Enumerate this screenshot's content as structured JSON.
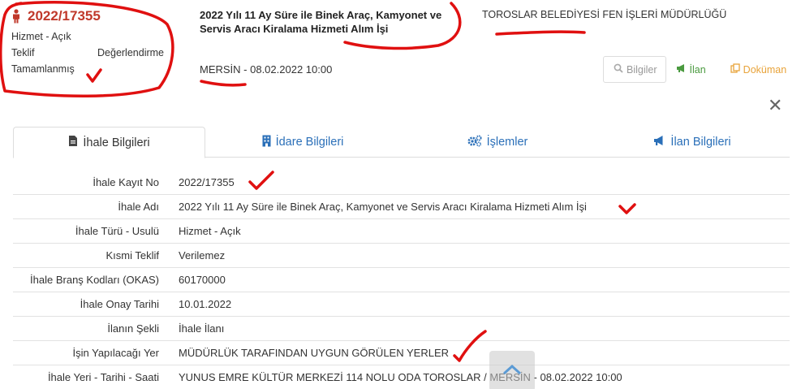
{
  "header": {
    "ikn": "2022/17355",
    "type_line": "Hizmet - Açık",
    "teklif_label": "Teklif",
    "status_eval": "Değerlendirme",
    "status_done": "Tamamlanmış",
    "title": "2022 Yılı 11 Ay Süre ile Binek Araç, Kamyonet ve Servis Aracı Kiralama Hizmeti Alım İşi",
    "organization": "TOROSLAR BELEDİYESİ FEN İŞLERİ MÜDÜRLÜĞÜ",
    "location_date": "MERSİN - 08.02.2022 10:00"
  },
  "actions": {
    "info": "Bilgiler",
    "ilan": "İlan",
    "document": "Doküman"
  },
  "tabs": [
    {
      "label": "İhale Bilgileri"
    },
    {
      "label": "İdare Bilgileri"
    },
    {
      "label": "İşlemler"
    },
    {
      "label": "İlan Bilgileri"
    }
  ],
  "details": [
    {
      "key": "İhale Kayıt No",
      "value": "2022/17355"
    },
    {
      "key": "İhale Adı",
      "value": "2022 Yılı 11 Ay Süre ile Binek Araç, Kamyonet ve Servis Aracı Kiralama Hizmeti Alım İşi"
    },
    {
      "key": "İhale Türü - Usulü",
      "value": "Hizmet - Açık"
    },
    {
      "key": "Kısmi Teklif",
      "value": "Verilemez"
    },
    {
      "key": "İhale Branş Kodları (OKAS)",
      "value": "60170000"
    },
    {
      "key": "İhale Onay Tarihi",
      "value": "10.01.2022"
    },
    {
      "key": "İlanın Şekli",
      "value": "İhale İlanı"
    },
    {
      "key": "İşin Yapılacağı Yer",
      "value": "MÜDÜRLÜK TARAFINDAN UYGUN GÖRÜLEN YERLER"
    },
    {
      "key": "İhale Yeri - Tarihi - Saati",
      "value": "YUNUS EMRE KÜLTÜR MERKEZİ 114 NOLU ODA TOROSLAR / MERSİN - 08.02.2022 10:00"
    }
  ],
  "colors": {
    "ikn": "#c0392b",
    "link": "#2a6fb8",
    "ilan": "#4a9a3f",
    "document": "#e8a33a",
    "annotation": "#e01010"
  },
  "icons": {
    "ikn": "person-icon",
    "info": "search-icon",
    "ilan": "megaphone-icon",
    "document": "copy-icon",
    "close": "close-icon",
    "tab1": "file-icon",
    "tab2": "building-icon",
    "tab3": "gears-icon",
    "tab4": "megaphone-icon",
    "scroll": "chevron-up-icon"
  }
}
